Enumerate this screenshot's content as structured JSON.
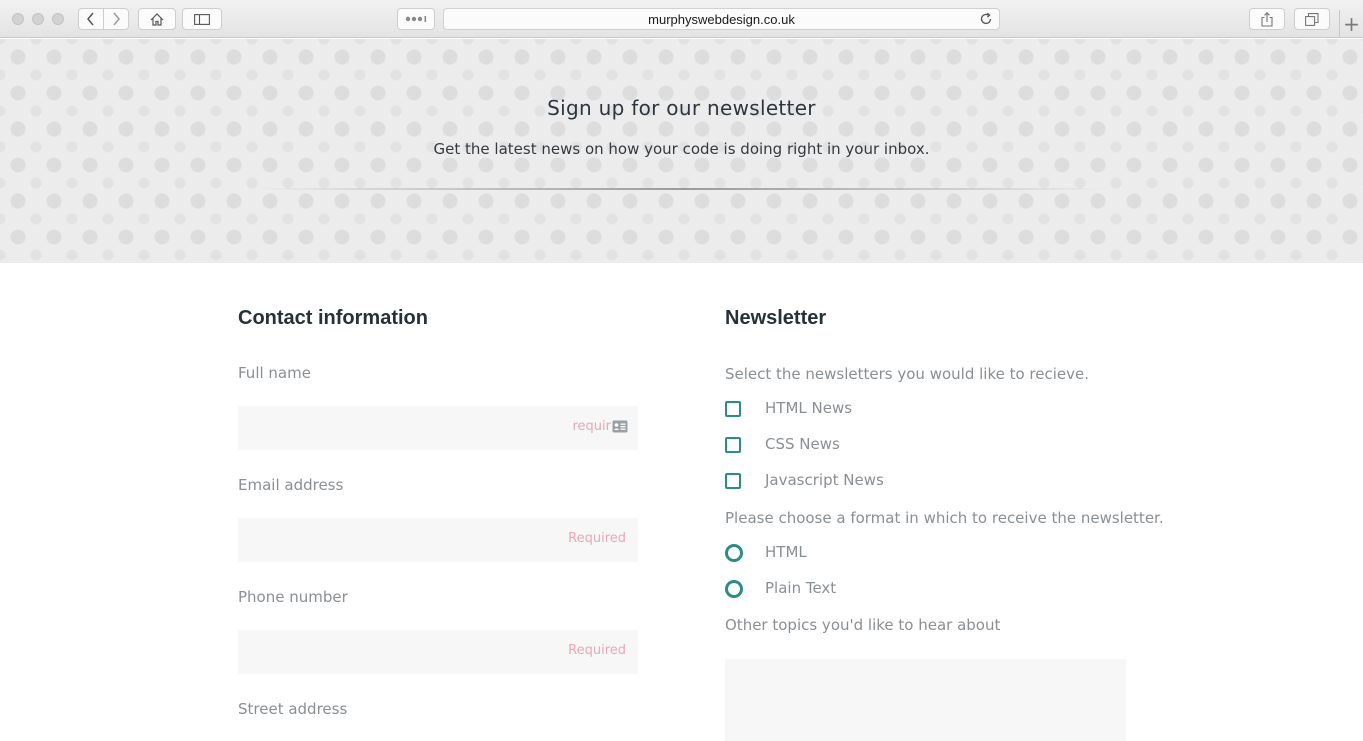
{
  "browser": {
    "url": "murphyswebdesign.co.uk"
  },
  "hero": {
    "title": "Sign up for our newsletter",
    "subtitle": "Get the latest news on how your code is doing right in your inbox."
  },
  "contact": {
    "heading": "Contact information",
    "full_name_label": "Full name",
    "full_name_required": "requir",
    "email_label": "Email address",
    "email_required": "Required",
    "phone_label": "Phone number",
    "phone_required": "Required",
    "street_label": "Street address"
  },
  "newsletter": {
    "heading": "Newsletter",
    "select_prompt": "Select the newsletters you would like to recieve.",
    "options": [
      {
        "label": "HTML News",
        "checked": false
      },
      {
        "label": "CSS News",
        "checked": false
      },
      {
        "label": "Javascript News",
        "checked": false
      }
    ],
    "format_prompt": "Please choose a format in which to receive the newsletter.",
    "formats": [
      {
        "label": "HTML",
        "selected": false
      },
      {
        "label": "Plain Text",
        "selected": false
      }
    ],
    "topics_label": "Other topics you'd like to hear about"
  },
  "colors": {
    "accent": "#2e8c86",
    "required_text": "#e8a7b8",
    "heading": "#263238",
    "label": "#8a8f94"
  },
  "icons": [
    "back-icon",
    "forward-icon",
    "home-icon",
    "sidebar-icon",
    "reader-icon",
    "reload-icon",
    "share-icon",
    "tabs-icon",
    "plus-icon",
    "contact-card-icon",
    "cursor-icon"
  ]
}
